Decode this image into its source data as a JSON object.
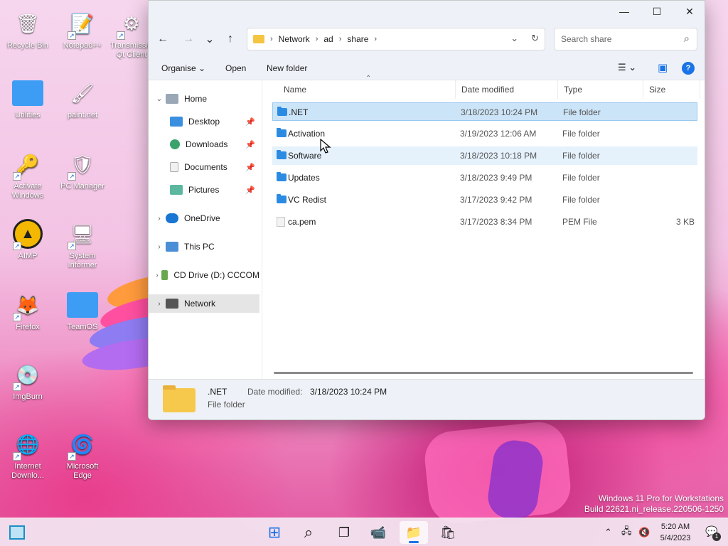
{
  "desktop": {
    "icons": [
      {
        "label": "Recycle Bin",
        "icon": "recycle-bin-icon",
        "glyph": "🗑"
      },
      {
        "label": "Notepad++",
        "icon": "notepadpp-icon",
        "glyph": "📝"
      },
      {
        "label": "Transmission Qt Client",
        "icon": "transmission-icon",
        "glyph": "⚙"
      },
      {
        "label": "Utilities",
        "icon": "folder-icon",
        "glyph": ""
      },
      {
        "label": "paint.net",
        "icon": "paintnet-icon",
        "glyph": "🖌"
      },
      {
        "label": "Activate Windows",
        "icon": "key-icon",
        "glyph": "🔑"
      },
      {
        "label": "PC Manager",
        "icon": "pc-manager-icon",
        "glyph": "🛡"
      },
      {
        "label": "AIMP",
        "icon": "aimp-icon",
        "glyph": "▲"
      },
      {
        "label": "System Informer",
        "icon": "system-informer-icon",
        "glyph": "🖥"
      },
      {
        "label": "Firefox",
        "icon": "firefox-icon",
        "glyph": "🦊"
      },
      {
        "label": "TeamOS",
        "icon": "folder-icon",
        "glyph": ""
      },
      {
        "label": "ImgBurn",
        "icon": "imgburn-icon",
        "glyph": "💿"
      },
      {
        "label": "Internet Downlo...",
        "icon": "idm-icon",
        "glyph": "🌐"
      },
      {
        "label": "Microsoft Edge",
        "icon": "edge-icon",
        "glyph": "🌀"
      }
    ]
  },
  "window": {
    "controls": {
      "minimize": "—",
      "maximize": "☐",
      "close": "✕"
    },
    "nav": {
      "back": "←",
      "forward": "→",
      "recent": "⌄",
      "up": "↑"
    },
    "breadcrumb": [
      "Network",
      "ad",
      "share"
    ],
    "breadcrumb_sep": "›",
    "address_dropdown": "⌄",
    "refresh": "↻",
    "search_placeholder": "Search share",
    "search_glyph": "⌕",
    "toolbar": {
      "organise": "Organise ⌄",
      "open": "Open",
      "new_folder": "New folder",
      "view_glyph": "☰  ⌄",
      "pane_glyph": "▣",
      "help": "?"
    },
    "sidebar": [
      {
        "label": "Home",
        "chevron": "⌄",
        "pinned": false
      },
      {
        "label": "Desktop",
        "chevron": "",
        "pinned": true
      },
      {
        "label": "Downloads",
        "chevron": "",
        "pinned": true
      },
      {
        "label": "Documents",
        "chevron": "",
        "pinned": true
      },
      {
        "label": "Pictures",
        "chevron": "",
        "pinned": true
      },
      {
        "label": "OneDrive",
        "chevron": "›",
        "pinned": false
      },
      {
        "label": "This PC",
        "chevron": "›",
        "pinned": false
      },
      {
        "label": "CD Drive (D:) CCCOM",
        "chevron": "›",
        "pinned": false
      },
      {
        "label": "Network",
        "chevron": "›",
        "pinned": false
      }
    ],
    "pin_glyph": "📌",
    "columns": {
      "name": "Name",
      "date": "Date modified",
      "type": "Type",
      "size": "Size"
    },
    "files": [
      {
        "name": ".NET",
        "date": "3/18/2023 10:24 PM",
        "type": "File folder",
        "size": "",
        "kind": "folder"
      },
      {
        "name": "Activation",
        "date": "3/19/2023 12:06 AM",
        "type": "File folder",
        "size": "",
        "kind": "folder"
      },
      {
        "name": "Software",
        "date": "3/18/2023 10:18 PM",
        "type": "File folder",
        "size": "",
        "kind": "folder"
      },
      {
        "name": "Updates",
        "date": "3/18/2023 9:49 PM",
        "type": "File folder",
        "size": "",
        "kind": "folder"
      },
      {
        "name": "VC Redist",
        "date": "3/17/2023 9:42 PM",
        "type": "File folder",
        "size": "",
        "kind": "folder"
      },
      {
        "name": "ca.pem",
        "date": "3/17/2023 8:34 PM",
        "type": "PEM File",
        "size": "3 KB",
        "kind": "file"
      }
    ],
    "details": {
      "name": ".NET",
      "type": "File folder",
      "date_label": "Date modified:",
      "date_value": "3/18/2023 10:24 PM"
    }
  },
  "watermark": {
    "line1": "Windows 11 Pro for Workstations",
    "line2": "Build 22621.ni_release.220506-1250"
  },
  "taskbar": {
    "apps": [
      {
        "name": "start",
        "glyph": "⊞"
      },
      {
        "name": "search",
        "glyph": "⌕"
      },
      {
        "name": "task-view",
        "glyph": "❐"
      },
      {
        "name": "teams",
        "glyph": "📹"
      },
      {
        "name": "file-explorer",
        "glyph": "📁"
      },
      {
        "name": "store",
        "glyph": "🛍"
      }
    ],
    "tray": {
      "chevron": "⌃",
      "network": "🖧",
      "volume": "🔇"
    },
    "clock_time": "5:20 AM",
    "clock_date": "5/4/2023",
    "notification_count": "1",
    "notification_glyph": "💬"
  },
  "colors": {
    "accent": "#1a73e8",
    "selection": "#cce4f7",
    "folder_blue": "#2b8be3",
    "folder_yellow": "#f6c84c"
  }
}
